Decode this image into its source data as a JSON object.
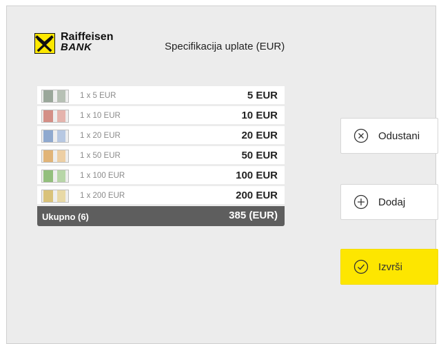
{
  "brand": {
    "line1": "Raiffeisen",
    "line2": "BANK"
  },
  "header": {
    "title": "Specifikacija uplate (EUR)"
  },
  "rows": [
    {
      "qty": "1 x 5 EUR",
      "amount": "5 EUR",
      "note_color": "#9aa79a"
    },
    {
      "qty": "1 x 10 EUR",
      "amount": "10 EUR",
      "note_color": "#d48f86"
    },
    {
      "qty": "1 x 20 EUR",
      "amount": "20 EUR",
      "note_color": "#8fa9cf"
    },
    {
      "qty": "1 x 50 EUR",
      "amount": "50 EUR",
      "note_color": "#e1b478"
    },
    {
      "qty": "1 x 100 EUR",
      "amount": "100 EUR",
      "note_color": "#93bf7d"
    },
    {
      "qty": "1 x 200 EUR",
      "amount": "200 EUR",
      "note_color": "#d9c27a"
    }
  ],
  "total": {
    "label": "Ukupno (6)",
    "value": "385 (EUR)"
  },
  "buttons": {
    "cancel": "Odustani",
    "add": "Dodaj",
    "execute": "Izvrši"
  },
  "colors": {
    "accent": "#fde600",
    "total_bg": "#5e5e5e",
    "panel_bg": "#ececec"
  }
}
